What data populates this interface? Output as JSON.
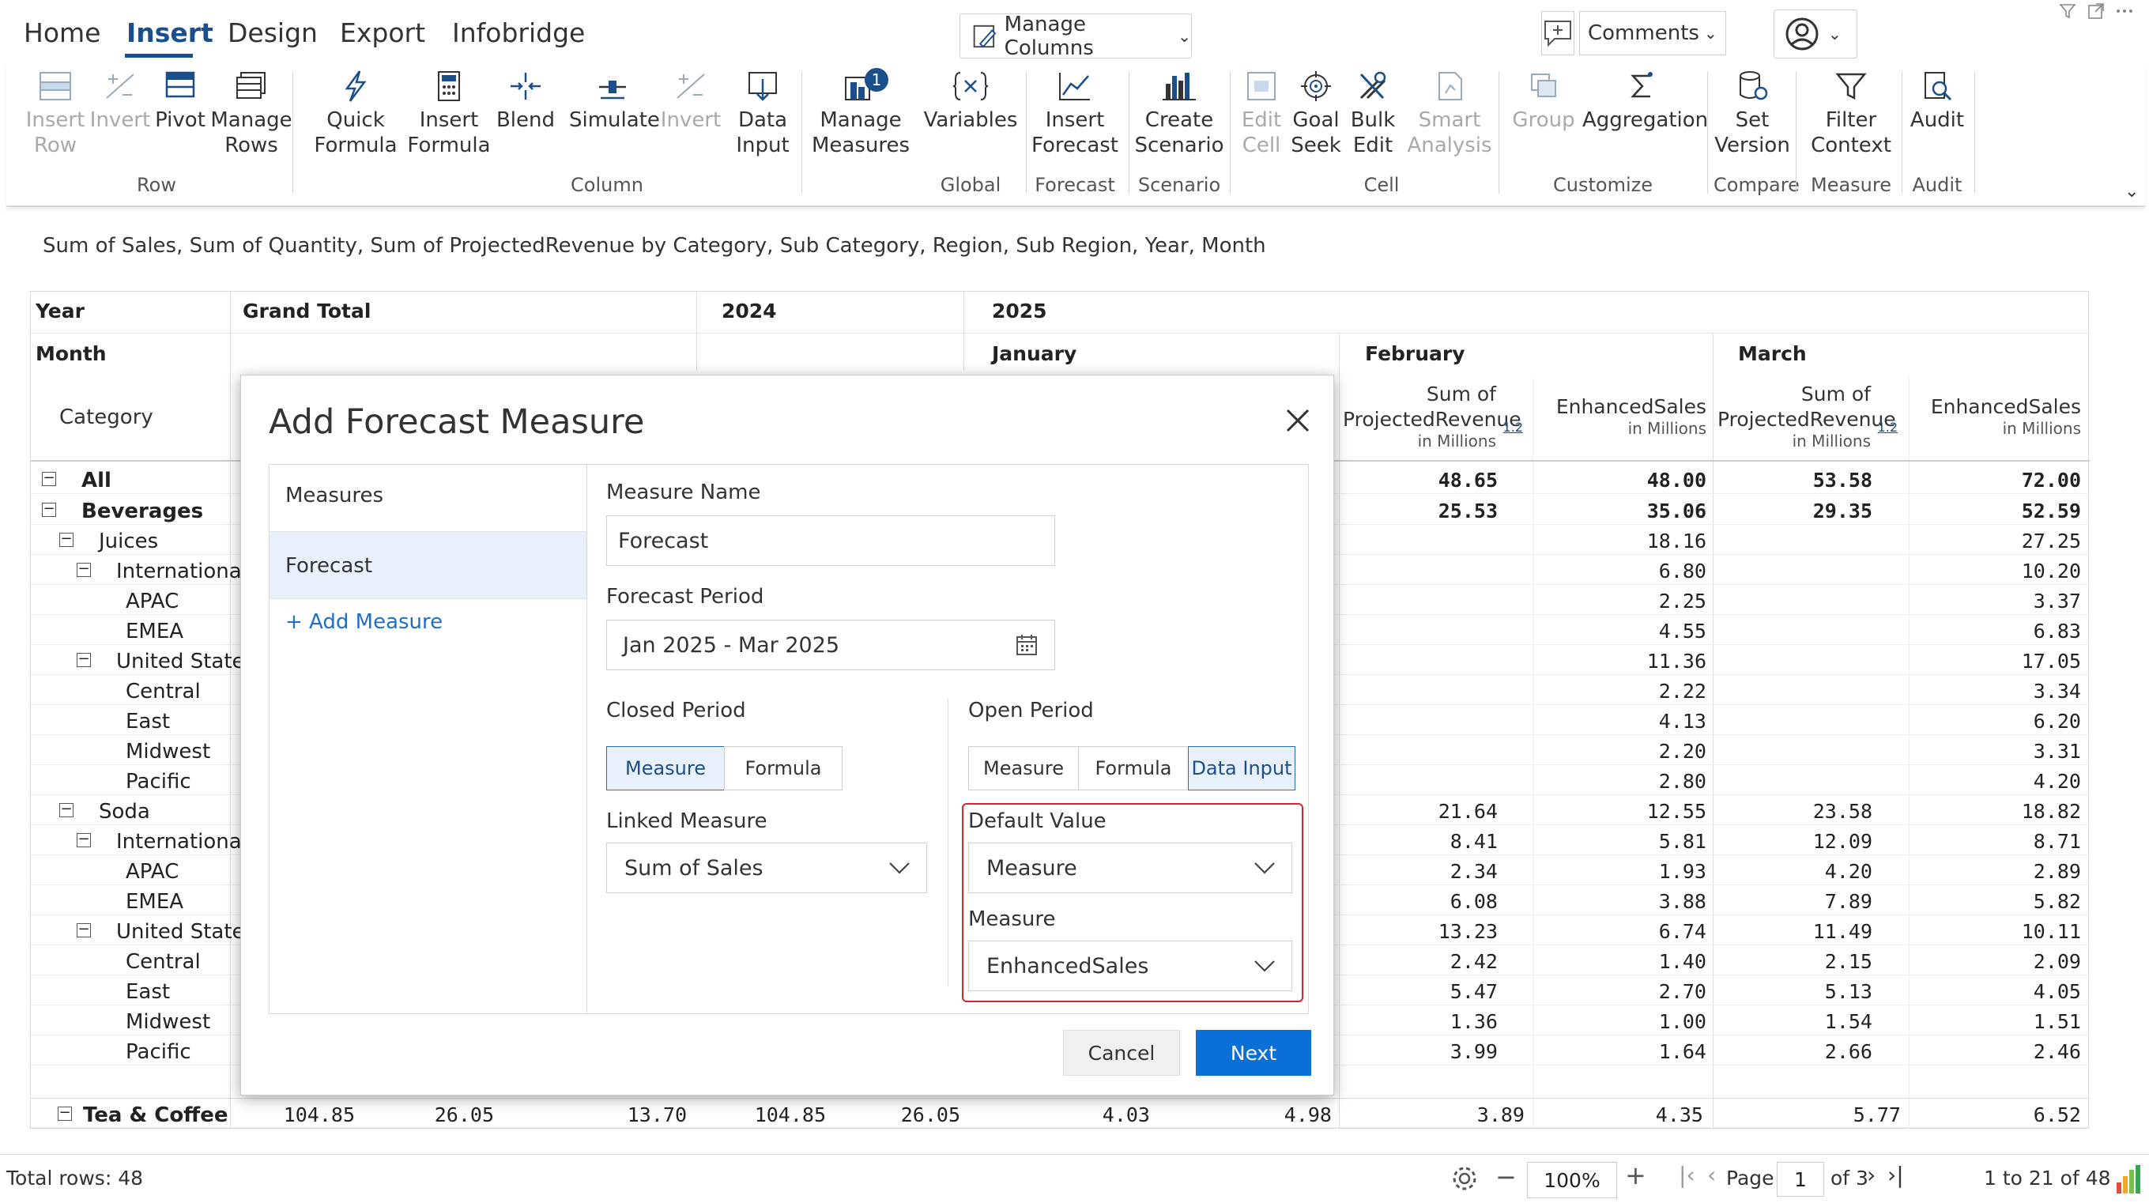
{
  "menu": {
    "home": "Home",
    "insert": "Insert",
    "design": "Design",
    "export": "Export",
    "infobridge": "Infobridge"
  },
  "top": {
    "manage_columns": "Manage Columns",
    "comments": "Comments"
  },
  "ribbon": {
    "insert_row": "Insert Row",
    "invert": "Invert",
    "pivot": "Pivot",
    "manage_rows": "Manage Rows",
    "quick_formula": "Quick Formula",
    "insert_formula": "Insert Formula",
    "blend": "Blend",
    "simulate": "Simulate",
    "invert2": "Invert",
    "data_input": "Data Input",
    "manage_measures": "Manage Measures",
    "measures_badge": "1",
    "variables": "Variables",
    "insert_forecast": "Insert Forecast",
    "create_scenario": "Create Scenario",
    "edit_cell": "Edit Cell",
    "goal_seek": "Goal Seek",
    "bulk_edit": "Bulk Edit",
    "smart_analysis": "Smart Analysis",
    "group": "Group",
    "aggregation": "Aggregation",
    "set_version": "Set Version",
    "filter_context": "Filter Context",
    "audit": "Audit",
    "groups": {
      "row": "Row",
      "column": "Column",
      "global": "Global",
      "forecast": "Forecast",
      "scenario": "Scenario",
      "cell": "Cell",
      "customize": "Customize",
      "compare": "Compare",
      "measure": "Measure",
      "audit": "Audit"
    }
  },
  "subtitle": "Sum of Sales, Sum of Quantity, Sum of ProjectedRevenue by Category, Sub Category, Region, Sub Region, Year, Month",
  "grid": {
    "year": "Year",
    "month": "Month",
    "category": "Category",
    "grand_total": "Grand Total",
    "y2024": "2024",
    "y2025": "2025",
    "january": "January",
    "february": "February",
    "march": "March",
    "col_sum": "Sum of",
    "col_proj": "ProjectedRevenue",
    "col_millions": "in Millions",
    "col_enh": "EnhancedSales",
    "col_fmt": "1.2",
    "rows": [
      {
        "label": "All",
        "feb_p": "48.65",
        "feb_e": "48.00",
        "mar_p": "53.58",
        "mar_e": "72.00"
      },
      {
        "label": "Beverages",
        "feb_p": "25.53",
        "feb_e": "35.06",
        "mar_p": "29.35",
        "mar_e": "52.59"
      },
      {
        "label": "Juices",
        "feb_p": "",
        "feb_e": "18.16",
        "mar_p": "",
        "mar_e": "27.25"
      },
      {
        "label": "International",
        "feb_p": "",
        "feb_e": "6.80",
        "mar_p": "",
        "mar_e": "10.20"
      },
      {
        "label": "APAC",
        "feb_p": "",
        "feb_e": "2.25",
        "mar_p": "",
        "mar_e": "3.37"
      },
      {
        "label": "EMEA",
        "feb_p": "",
        "feb_e": "4.55",
        "mar_p": "",
        "mar_e": "6.83"
      },
      {
        "label": "United States",
        "feb_p": "",
        "feb_e": "11.36",
        "mar_p": "",
        "mar_e": "17.05"
      },
      {
        "label": "Central",
        "feb_p": "",
        "feb_e": "2.22",
        "mar_p": "",
        "mar_e": "3.34"
      },
      {
        "label": "East",
        "feb_p": "",
        "feb_e": "4.13",
        "mar_p": "",
        "mar_e": "6.20"
      },
      {
        "label": "Midwest",
        "feb_p": "",
        "feb_e": "2.20",
        "mar_p": "",
        "mar_e": "3.31"
      },
      {
        "label": "Pacific",
        "feb_p": "",
        "feb_e": "2.80",
        "mar_p": "",
        "mar_e": "4.20"
      },
      {
        "label": "Soda",
        "feb_p": "21.64",
        "feb_e": "12.55",
        "mar_p": "23.58",
        "mar_e": "18.82"
      },
      {
        "label": "International",
        "feb_p": "8.41",
        "feb_e": "5.81",
        "mar_p": "12.09",
        "mar_e": "8.71"
      },
      {
        "label": "APAC",
        "feb_p": "2.34",
        "feb_e": "1.93",
        "mar_p": "4.20",
        "mar_e": "2.89"
      },
      {
        "label": "EMEA",
        "feb_p": "6.08",
        "feb_e": "3.88",
        "mar_p": "7.89",
        "mar_e": "5.82"
      },
      {
        "label": "United States",
        "feb_p": "13.23",
        "feb_e": "6.74",
        "mar_p": "11.49",
        "mar_e": "10.11"
      },
      {
        "label": "Central",
        "feb_p": "2.42",
        "feb_e": "1.40",
        "mar_p": "2.15",
        "mar_e": "2.09"
      },
      {
        "label": "East",
        "feb_p": "5.47",
        "feb_e": "2.70",
        "mar_p": "5.13",
        "mar_e": "4.05"
      },
      {
        "label": "Midwest",
        "feb_p": "1.36",
        "feb_e": "1.00",
        "mar_p": "1.54",
        "mar_e": "1.51"
      },
      {
        "label": "Pacific",
        "feb_p": "3.99",
        "feb_e": "1.64",
        "mar_p": "2.66",
        "mar_e": "2.46"
      }
    ],
    "last_row": {
      "label": "Tea & Coffee",
      "v1": "104.85",
      "v2": "26.05",
      "v3": "13.70",
      "v4": "104.85",
      "v5": "26.05",
      "v6": "4.03",
      "v7": "4.98",
      "v8": "3.89",
      "v9": "4.35",
      "v10": "5.77",
      "v11": "6.52"
    }
  },
  "modal": {
    "title": "Add Forecast Measure",
    "measures_header": "Measures",
    "forecast_item": "Forecast",
    "add_measure": "+ Add Measure",
    "measure_name_label": "Measure Name",
    "measure_name_value": "Forecast",
    "forecast_period_label": "Forecast Period",
    "forecast_period_value": "Jan 2025 - Mar 2025",
    "closed_period": "Closed Period",
    "closed_measure": "Measure",
    "closed_formula": "Formula",
    "linked_measure_label": "Linked Measure",
    "linked_measure_value": "Sum of Sales",
    "open_period": "Open Period",
    "open_measure": "Measure",
    "open_formula": "Formula",
    "open_data_input": "Data Input",
    "default_value_label": "Default Value",
    "default_value_value": "Measure",
    "measure_label": "Measure",
    "measure_value": "EnhancedSales",
    "cancel": "Cancel",
    "next": "Next"
  },
  "status": {
    "total_rows": "Total rows: 48",
    "zoom": "100%",
    "page_label": "Page",
    "page_value": "1",
    "of_pages": "of 3",
    "range": "1 to 21 of 48"
  },
  "colors": {
    "accent": "#1a4f8b",
    "primary_button": "#0a6fd6",
    "highlight_box": "#d9232e",
    "selected_bg": "#e8f1fb"
  }
}
